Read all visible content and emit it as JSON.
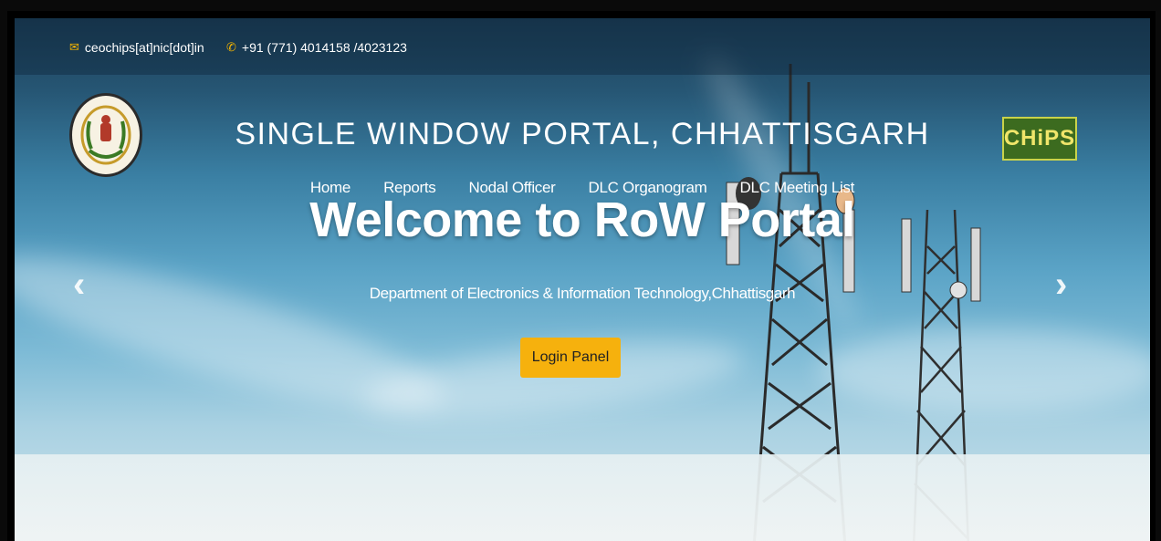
{
  "topbar": {
    "email": "ceochips[at]nic[dot]in",
    "phone": "+91 (771) 4014158 /4023123",
    "email_icon": "envelope-icon",
    "phone_icon": "phone-icon"
  },
  "header": {
    "title": "SINGLE WINDOW PORTAL, CHHATTISGARH",
    "logo_left": "chhattisgarh-emblem-logo",
    "logo_right": "chips-logo",
    "logo_right_text": "CHiPS"
  },
  "nav": {
    "items": [
      {
        "label": "Home"
      },
      {
        "label": "Reports"
      },
      {
        "label": "Nodal Officer"
      },
      {
        "label": "DLC Organogram"
      },
      {
        "label": "DLC Meeting List"
      }
    ]
  },
  "hero": {
    "headline": "Welcome to RoW Portal",
    "subtitle": "Department of Electronics & Information Technology,Chhattisgarh",
    "login_label": "Login Panel",
    "prev_icon": "chevron-left-icon",
    "next_icon": "chevron-right-icon"
  },
  "colors": {
    "accent": "#f6b10d",
    "sky_top": "#1d3f57",
    "sky_bottom": "#cfe4ec"
  }
}
